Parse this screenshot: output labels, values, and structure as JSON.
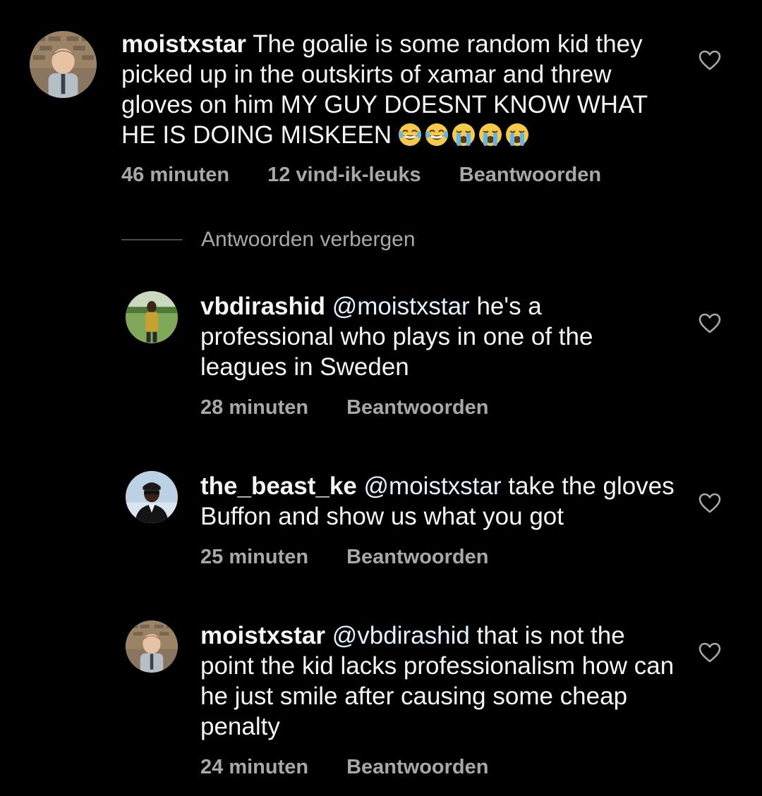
{
  "comments": [
    {
      "username": "moistxstar",
      "mention": "",
      "text": "The goalie is some random kid they picked up in the outskirts of xamar and threw gloves on him MY GUY DOESNT KNOW WHAT HE IS DOING MISKEEN",
      "emojis": [
        "joy-emoji",
        "joy-emoji",
        "sob-emoji",
        "sob-emoji",
        "sob-emoji"
      ],
      "time": "46 minuten",
      "likes": "12 vind-ik-leuks",
      "reply": "Beantwoorden"
    },
    {
      "username": "vbdirashid",
      "mention": "@moistxstar",
      "text": "he's a professional who plays in one of the leagues in Sweden",
      "time": "28 minuten",
      "reply": "Beantwoorden"
    },
    {
      "username": "the_beast_ke",
      "mention": "@moistxstar",
      "text": "take the gloves Buffon and show us what you got",
      "time": "25 minuten",
      "reply": "Beantwoorden"
    },
    {
      "username": "moistxstar",
      "mention": "@vbdirashid",
      "text": "that is not the point the kid lacks professionalism how can he just smile after causing some cheap penalty",
      "time": "24 minuten",
      "reply": "Beantwoorden"
    }
  ],
  "hide_replies_label": "Antwoorden verbergen",
  "icons": {
    "like": "heart-outline-icon"
  },
  "colors": {
    "background": "#000000",
    "text": "#f5f5f5",
    "secondary": "#a8a8a8",
    "mention": "#e0f1ff"
  }
}
